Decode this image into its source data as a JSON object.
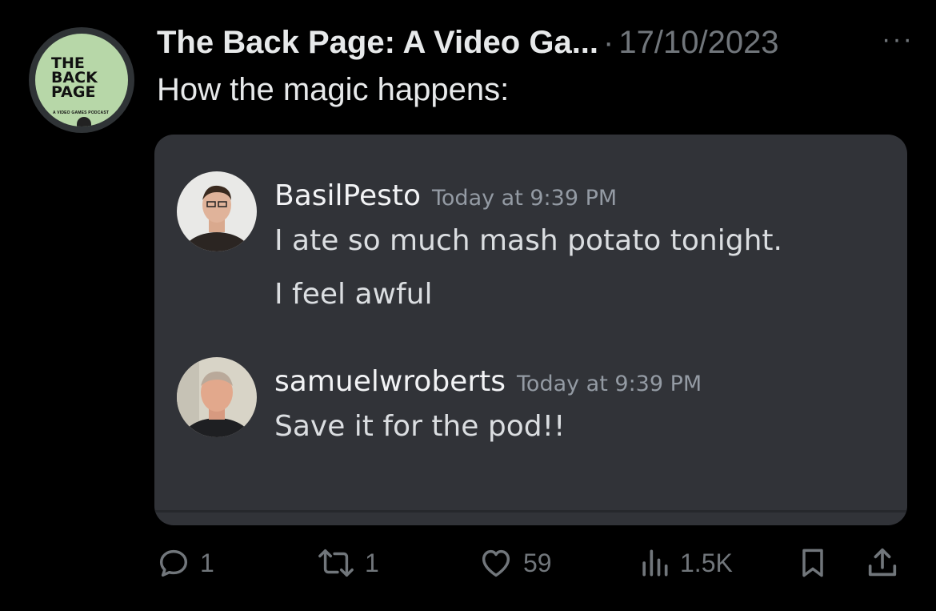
{
  "tweet": {
    "author": "The Back Page: A Video Ga...",
    "separator": "·",
    "date": "17/10/2023",
    "more_label": "···",
    "text": "How the magic happens:"
  },
  "avatar": {
    "logo_lines": [
      "THE",
      "BACK",
      "PAGE"
    ],
    "logo_sub": "A VIDEO GAMES PODCAST",
    "bg_color": "#b7d7a8"
  },
  "chat": {
    "messages": [
      {
        "username": "BasilPesto",
        "timestamp": "Today at 9:39 PM",
        "lines": [
          "I ate so much mash potato tonight.",
          "I feel awful"
        ]
      },
      {
        "username": "samuelwroberts",
        "timestamp": "Today at 9:39 PM",
        "lines": [
          "Save it for the pod!!"
        ]
      }
    ]
  },
  "actions": {
    "replies": "1",
    "reposts": "1",
    "likes": "59",
    "views": "1.5K"
  },
  "colors": {
    "background": "#000000",
    "card": "#313338",
    "muted": "#71767b",
    "text": "#e7e9ea"
  }
}
